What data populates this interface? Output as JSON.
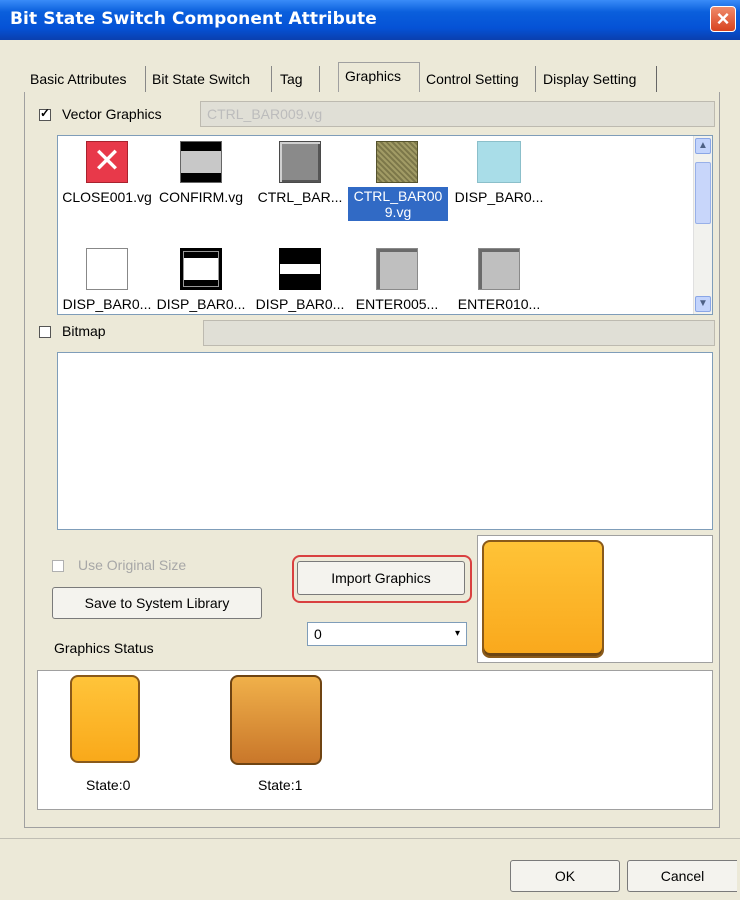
{
  "window": {
    "title": "Bit State Switch Component Attribute",
    "close_icon": "close-icon"
  },
  "tabs": [
    {
      "label": "Basic Attributes",
      "active": false
    },
    {
      "label": "Bit State Switch",
      "active": false
    },
    {
      "label": "Tag",
      "active": false
    },
    {
      "label": "Graphics",
      "active": true
    },
    {
      "label": "Control Setting",
      "active": false
    },
    {
      "label": "Display Setting",
      "active": false
    }
  ],
  "vector": {
    "checkbox_label": "Vector Graphics",
    "checked": true,
    "selected_file": "CTRL_BAR009.vg",
    "items": [
      {
        "name": "CLOSE001.vg",
        "icon": "close-x-thumbnail",
        "selected": false
      },
      {
        "name": "CONFIRM.vg",
        "icon": "confirm-bar-thumbnail",
        "selected": false
      },
      {
        "name": "CTRL_BAR...",
        "icon": "gray-button-thumbnail",
        "selected": false
      },
      {
        "name": "CTRL_BAR009.vg",
        "name_line1": "CTRL_BAR00",
        "name_line2": "9.vg",
        "icon": "olive-button-thumbnail",
        "selected": true
      },
      {
        "name": "DISP_BAR0...",
        "icon": "cyan-bar-thumbnail",
        "selected": false
      },
      {
        "name": "DISP_BAR0...",
        "icon": "white-bar-thumbnail",
        "selected": false
      },
      {
        "name": "DISP_BAR0...",
        "icon": "framed-bar-thumbnail",
        "selected": false
      },
      {
        "name": "DISP_BAR0...",
        "icon": "black-stripe-thumbnail",
        "selected": false
      },
      {
        "name": "ENTER005...",
        "icon": "enter-thumbnail",
        "selected": false
      },
      {
        "name": "ENTER010...",
        "icon": "enter-thumbnail",
        "selected": false
      }
    ]
  },
  "bitmap": {
    "checkbox_label": "Bitmap",
    "checked": false,
    "field_value": ""
  },
  "options": {
    "use_original_size": "Use Original Size",
    "use_original_size_enabled": false,
    "import_button": "Import Graphics",
    "save_button": "Save to System Library"
  },
  "graphics_status": {
    "label": "Graphics Status",
    "selected": "0"
  },
  "states": [
    {
      "label": "State:0",
      "color_top": "#ffc43a",
      "color_bottom": "#f9a91a"
    },
    {
      "label": "State:1",
      "color_top": "#f0b04a",
      "color_bottom": "#c9772a"
    }
  ],
  "preview_color": "#fdb022",
  "footer": {
    "ok": "OK",
    "cancel": "Cancel"
  }
}
